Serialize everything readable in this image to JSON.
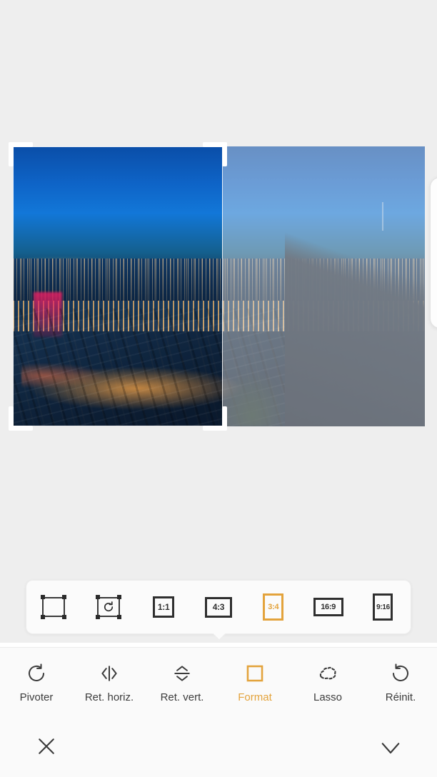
{
  "accent_color": "#e3a33c",
  "workspace": {
    "background": "#eeeeee",
    "photo": {
      "description": "Aerial night view of Paris cityscape with illuminated streets under a deep blue dusk sky",
      "crop_handles": [
        "top-left",
        "top-right",
        "bottom-left",
        "bottom-right"
      ]
    }
  },
  "ratio_popup": {
    "options": [
      {
        "id": "free",
        "label": "",
        "icon": "crop-frame-icon",
        "selected": false
      },
      {
        "id": "rotate_frame",
        "label": "",
        "icon": "rotate-frame-icon",
        "selected": false
      },
      {
        "id": "1_1",
        "label": "1:1",
        "icon": "ratio-box-icon",
        "selected": false
      },
      {
        "id": "4_3",
        "label": "4:3",
        "icon": "ratio-box-icon",
        "selected": false
      },
      {
        "id": "3_4",
        "label": "3:4",
        "icon": "ratio-box-icon",
        "selected": true
      },
      {
        "id": "16_9",
        "label": "16:9",
        "icon": "ratio-box-icon",
        "selected": false
      },
      {
        "id": "9_16",
        "label": "9:16",
        "icon": "ratio-box-icon",
        "selected": false
      }
    ]
  },
  "tools": [
    {
      "id": "rotate",
      "label": "Pivoter",
      "icon": "rotate-ccw-icon",
      "active": false
    },
    {
      "id": "flip_h",
      "label": "Ret. horiz.",
      "icon": "flip-horizontal-icon",
      "active": false
    },
    {
      "id": "flip_v",
      "label": "Ret. vert.",
      "icon": "flip-vertical-icon",
      "active": false
    },
    {
      "id": "format",
      "label": "Format",
      "icon": "square-outline-icon",
      "active": true
    },
    {
      "id": "lasso",
      "label": "Lasso",
      "icon": "lasso-icon",
      "active": false
    },
    {
      "id": "reset",
      "label": "Réinit.",
      "icon": "reset-icon",
      "active": false
    }
  ],
  "confirm_bar": {
    "cancel": {
      "id": "cancel",
      "icon": "close-icon"
    },
    "apply": {
      "id": "apply",
      "icon": "check-icon"
    }
  }
}
